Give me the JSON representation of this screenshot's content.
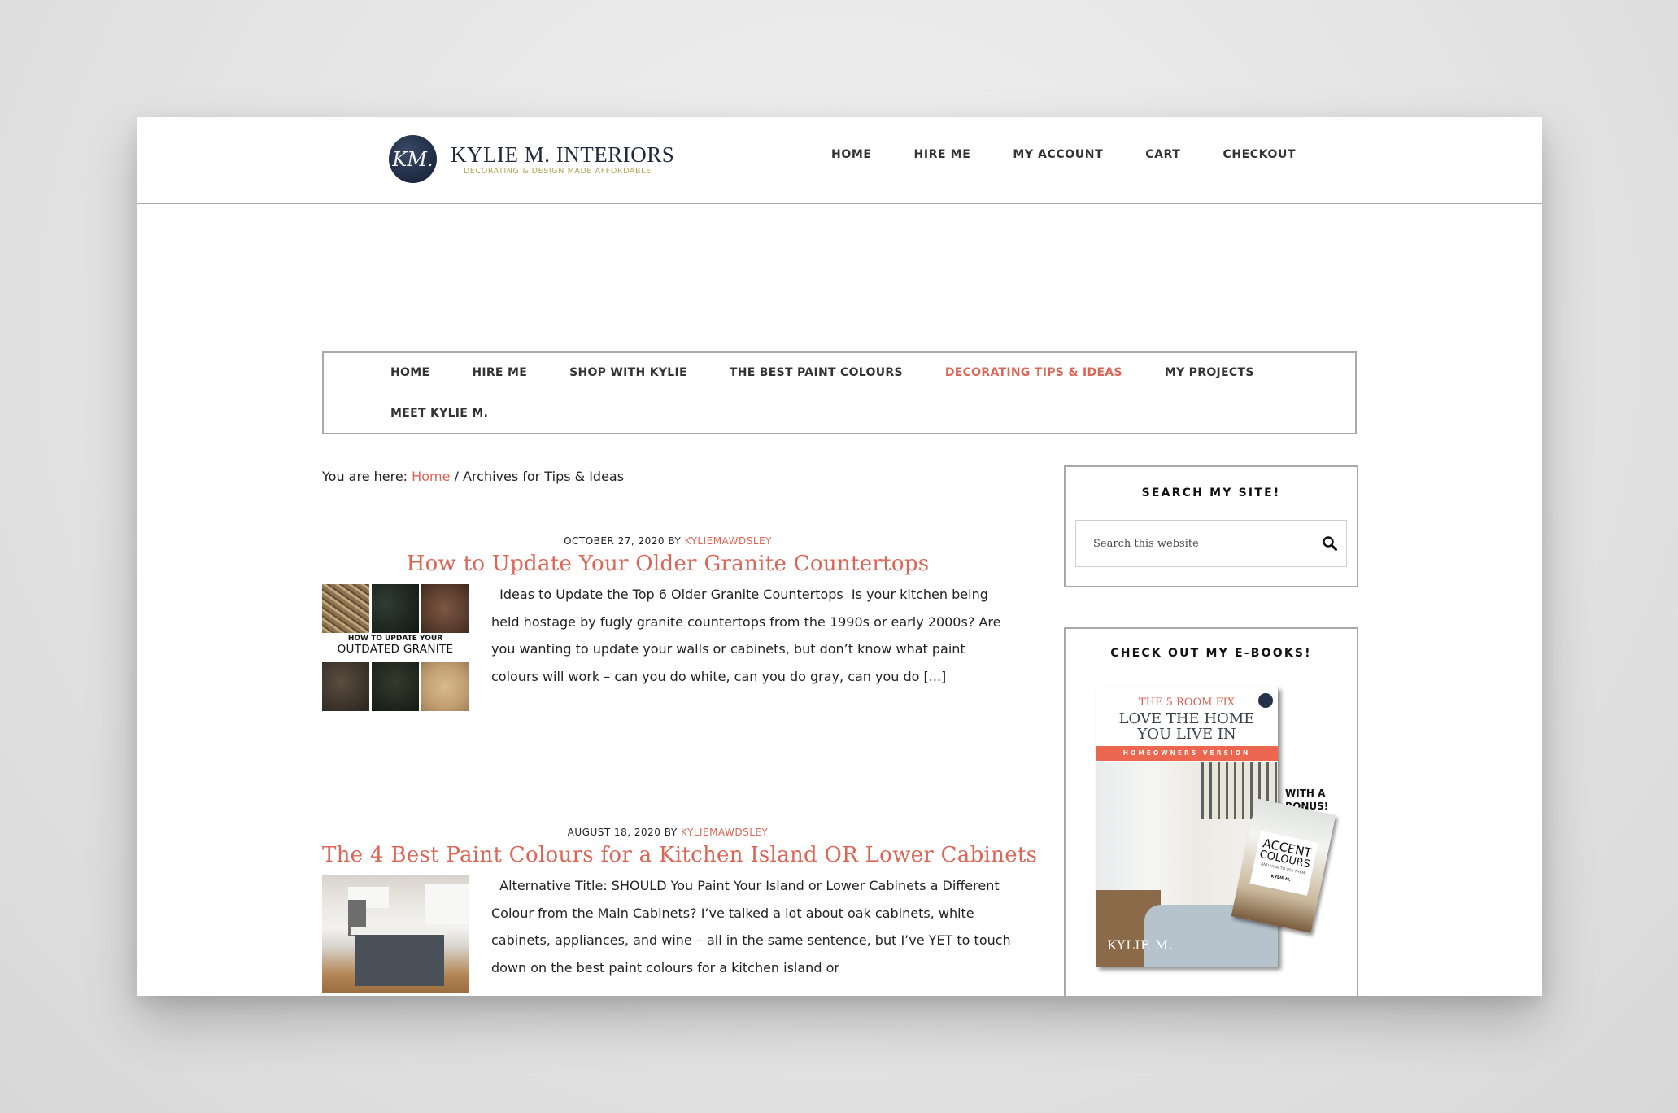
{
  "header": {
    "logo_monogram": "KM.",
    "logo_title": "KYLIE M. INTERIORS",
    "logo_tagline": "DECORATING & DESIGN MADE AFFORDABLE",
    "nav": [
      "HOME",
      "HIRE ME",
      "MY ACCOUNT",
      "CART",
      "CHECKOUT"
    ]
  },
  "sub_nav": {
    "items": [
      "HOME",
      "HIRE ME",
      "SHOP WITH KYLIE",
      "THE BEST PAINT COLOURS",
      "DECORATING TIPS & IDEAS",
      "MY PROJECTS",
      "MEET KYLIE M."
    ],
    "active": "DECORATING TIPS & IDEAS"
  },
  "breadcrumb": {
    "prefix": "You are here: ",
    "home": "Home",
    "separator": " / ",
    "current": "Archives for Tips & Ideas"
  },
  "posts": [
    {
      "date": "OCTOBER 27, 2020",
      "by": " BY ",
      "author": "KYLIEMAWDSLEY",
      "title": "How to Update Your Older Granite Countertops",
      "thumb_caption_1": "HOW TO UPDATE YOUR",
      "thumb_caption_2": "OUTDATED GRANITE",
      "excerpt": "  Ideas to Update the Top 6 Older Granite Countertops  Is your kitchen being held hostage by fugly granite countertops from the 1990s or early 2000s? Are you wanting to update your walls or cabinets, but don’t know what paint colours will work – can you do white, can you do gray, can you do [...]"
    },
    {
      "date": "AUGUST 18, 2020",
      "by": " BY ",
      "author": "KYLIEMAWDSLEY",
      "title": "The 4 Best Paint Colours for a Kitchen Island OR Lower Cabinets",
      "excerpt": "  Alternative Title: SHOULD You Paint Your Island or Lower Cabinets a Different Colour from the Main Cabinets? I’ve talked a lot about oak cabinets, white cabinets, appliances, and wine – all in the same sentence, but I’ve YET to touch down on the best paint colours for a kitchen island or"
    }
  ],
  "sidebar": {
    "search": {
      "title": "SEARCH MY SITE!",
      "placeholder": "Search this website",
      "value": "",
      "icon": "search-icon"
    },
    "ebooks": {
      "title": "CHECK OUT MY E-BOOKS!",
      "cover_kicker": "THE 5 ROOM FIX",
      "cover_headline_1": "LOVE THE HOME",
      "cover_headline_2": "YOU LIVE IN",
      "cover_band": "HOMEOWNERS VERSION",
      "cover_author": "KYLIE M.",
      "bonus_label_1": "WITH A",
      "bonus_label_2": "BONUS!",
      "bonus_title_1": "ACCENT",
      "bonus_title_2": "COLOURS",
      "bonus_subtitle": "AND HOW TO USE THEM",
      "bonus_author": "KYLIE M."
    }
  },
  "colors": {
    "accent": "#dd6556",
    "text": "#222222",
    "border": "#a9a9a9",
    "tagline_gold": "#b2a454",
    "logo_navy": "#1d2a42"
  }
}
